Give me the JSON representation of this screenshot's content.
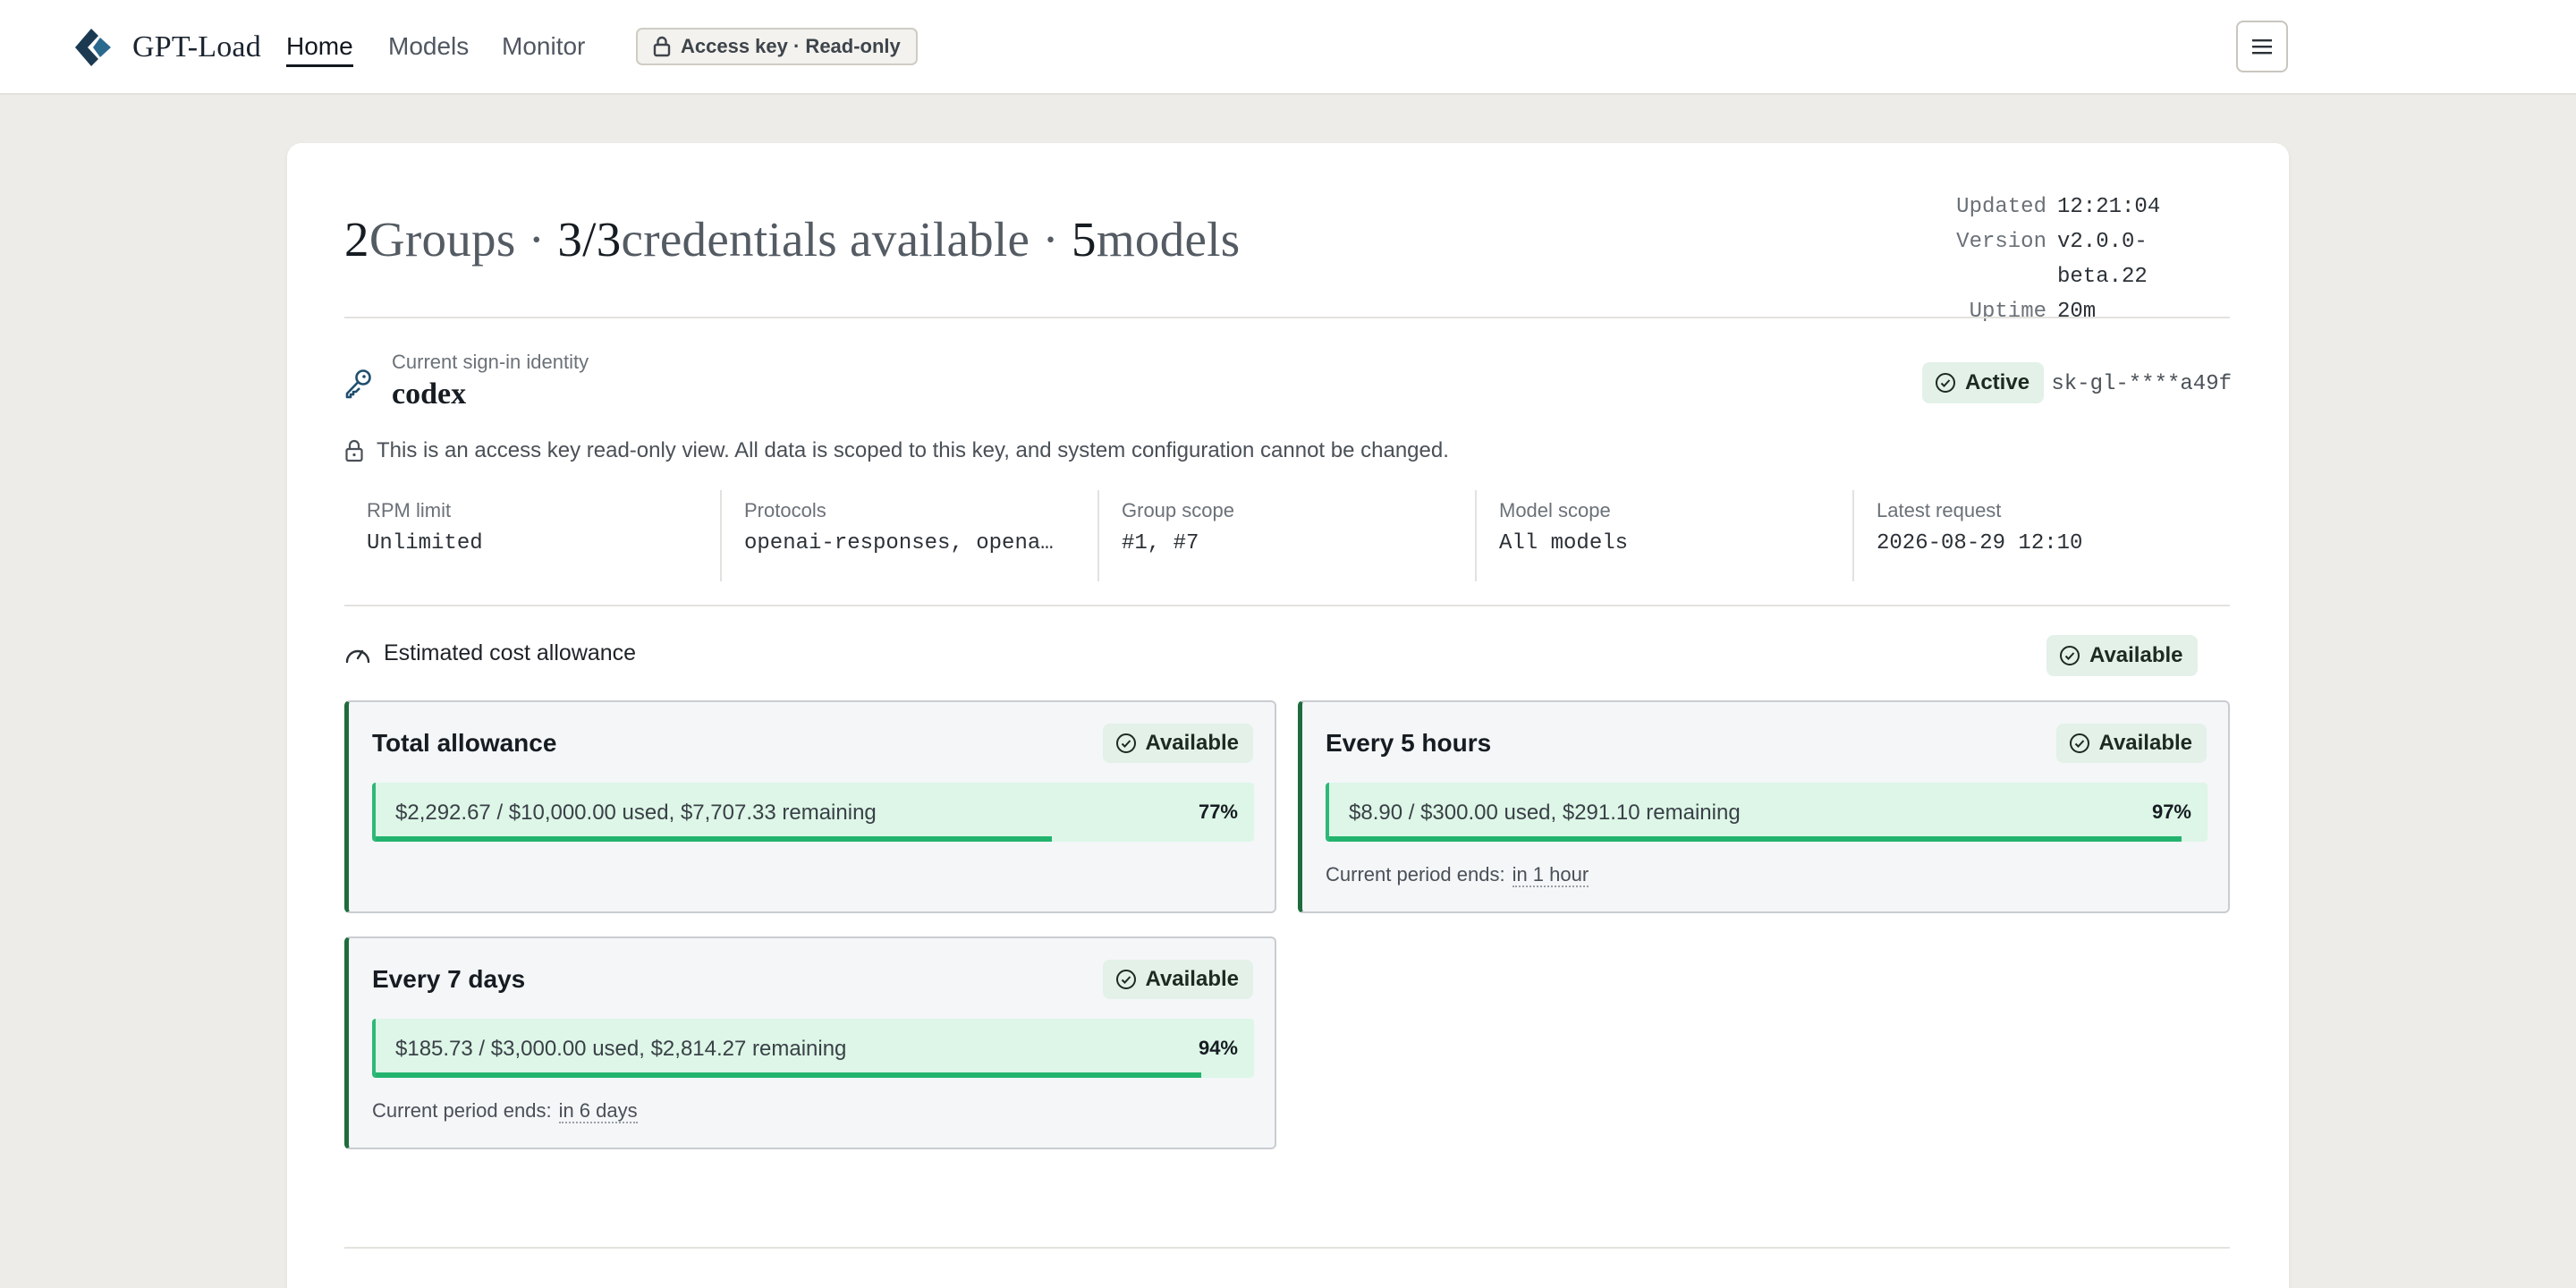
{
  "app": {
    "name": "GPT-Load"
  },
  "nav": {
    "items": [
      {
        "label": "Home",
        "active": true
      },
      {
        "label": "Models",
        "active": false
      },
      {
        "label": "Monitor",
        "active": false
      }
    ],
    "access_pill": "Access key · Read-only",
    "menu_icon": "hamburger-icon"
  },
  "summary": {
    "groups_count": "2",
    "groups_label": "Groups",
    "sep": "·",
    "credentials_count": "3/3",
    "credentials_label": "credentials available",
    "models_count": "5",
    "models_label": "models"
  },
  "meta": {
    "updated_label": "Updated",
    "updated_value": "12:21:04",
    "version_label": "Version",
    "version_value": "v2.0.0-beta.22",
    "uptime_label": "Uptime",
    "uptime_value": "20m"
  },
  "identity": {
    "label": "Current sign-in identity",
    "name": "codex",
    "status": "Active",
    "key_masked": "sk-gl-****a49f",
    "notice": "This is an access key read-only view. All data is scoped to this key, and system configuration cannot be changed."
  },
  "stats": [
    {
      "label": "RPM limit",
      "value": "Unlimited"
    },
    {
      "label": "Protocols",
      "value": "openai-responses, openai-…"
    },
    {
      "label": "Group scope",
      "value": "#1, #7"
    },
    {
      "label": "Model scope",
      "value": "All models"
    },
    {
      "label": "Latest request",
      "value": "2026-08-29 12:10"
    }
  ],
  "allowance": {
    "title": "Estimated cost allowance",
    "status": "Available",
    "tiles": [
      {
        "title": "Total allowance",
        "status": "Available",
        "usage": "$2,292.67 / $10,000.00 used, $7,707.33 remaining",
        "pct_label": "77%",
        "pct": 0.77,
        "period_label": "",
        "period_value": ""
      },
      {
        "title": "Every 5 hours",
        "status": "Available",
        "usage": "$8.90 / $300.00 used, $291.10 remaining",
        "pct_label": "97%",
        "pct": 0.97,
        "period_label": "Current period ends:",
        "period_value": "in 1 hour"
      },
      {
        "title": "Every 7 days",
        "status": "Available",
        "usage": "$185.73 / $3,000.00 used, $2,814.27 remaining",
        "pct_label": "94%",
        "pct": 0.94,
        "period_label": "Current period ends:",
        "period_value": "in 6 days"
      }
    ]
  },
  "colors": {
    "accent_green": "#22b36e",
    "badge_bg": "#e3f1e8",
    "brand": "#1b3a52"
  }
}
